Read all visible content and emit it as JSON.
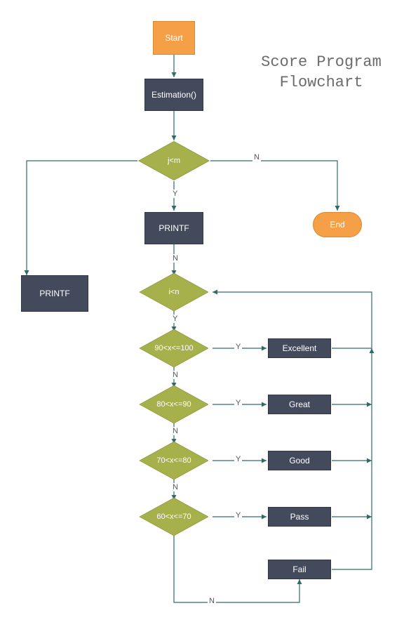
{
  "title": {
    "line1": "Score Program",
    "line2": "Flowchart"
  },
  "nodes": {
    "start": "Start",
    "estimation": "Estimation()",
    "jm": "j<m",
    "printf1": "PRINTF",
    "printf2": "PRINTF",
    "in": "i<n",
    "c1": "90<x<=100",
    "c2": "80<x<=90",
    "c3": "70<x<=80",
    "c4": "60<x<=70",
    "r1": "Excellent",
    "r2": "Great",
    "r3": "Good",
    "r4": "Pass",
    "r5": "Fail",
    "end": "End"
  },
  "labels": {
    "Y": "Y",
    "N": "N"
  },
  "colors": {
    "orange": "#f5a047",
    "dark": "#434a5c",
    "olive": "#a7b14b",
    "arrow": "#2e6b6b"
  },
  "chart_data": {
    "type": "flowchart",
    "title": "Score Program Flowchart",
    "nodes": [
      {
        "id": "start",
        "type": "terminator",
        "label": "Start"
      },
      {
        "id": "estimation",
        "type": "process",
        "label": "Estimation()"
      },
      {
        "id": "jm",
        "type": "decision",
        "label": "j<m"
      },
      {
        "id": "printf1",
        "type": "process",
        "label": "PRINTF"
      },
      {
        "id": "printf2",
        "type": "process",
        "label": "PRINTF"
      },
      {
        "id": "in",
        "type": "decision",
        "label": "i<n"
      },
      {
        "id": "c1",
        "type": "decision",
        "label": "90<x<=100"
      },
      {
        "id": "c2",
        "type": "decision",
        "label": "80<x<=90"
      },
      {
        "id": "c3",
        "type": "decision",
        "label": "70<x<=80"
      },
      {
        "id": "c4",
        "type": "decision",
        "label": "60<x<=70"
      },
      {
        "id": "r1",
        "type": "process",
        "label": "Excellent"
      },
      {
        "id": "r2",
        "type": "process",
        "label": "Great"
      },
      {
        "id": "r3",
        "type": "process",
        "label": "Good"
      },
      {
        "id": "r4",
        "type": "process",
        "label": "Pass"
      },
      {
        "id": "r5",
        "type": "process",
        "label": "Fail"
      },
      {
        "id": "end",
        "type": "terminator",
        "label": "End"
      }
    ],
    "edges": [
      {
        "from": "start",
        "to": "estimation"
      },
      {
        "from": "estimation",
        "to": "jm"
      },
      {
        "from": "jm",
        "to": "printf1",
        "label": "Y"
      },
      {
        "from": "jm",
        "to": "end",
        "label": "N"
      },
      {
        "from": "jm",
        "to": "printf2"
      },
      {
        "from": "printf1",
        "to": "in",
        "label": "N"
      },
      {
        "from": "in",
        "to": "c1",
        "label": "Y"
      },
      {
        "from": "c1",
        "to": "r1",
        "label": "Y"
      },
      {
        "from": "c1",
        "to": "c2",
        "label": "N"
      },
      {
        "from": "c2",
        "to": "r2",
        "label": "Y"
      },
      {
        "from": "c2",
        "to": "c3",
        "label": "N"
      },
      {
        "from": "c3",
        "to": "r3",
        "label": "Y"
      },
      {
        "from": "c3",
        "to": "c4",
        "label": "N"
      },
      {
        "from": "c4",
        "to": "r4",
        "label": "Y"
      },
      {
        "from": "c4",
        "to": "r5",
        "label": "N"
      },
      {
        "from": "r1",
        "to": "in"
      },
      {
        "from": "r2",
        "to": "in"
      },
      {
        "from": "r3",
        "to": "in"
      },
      {
        "from": "r4",
        "to": "in"
      },
      {
        "from": "r5",
        "to": "in"
      }
    ]
  }
}
